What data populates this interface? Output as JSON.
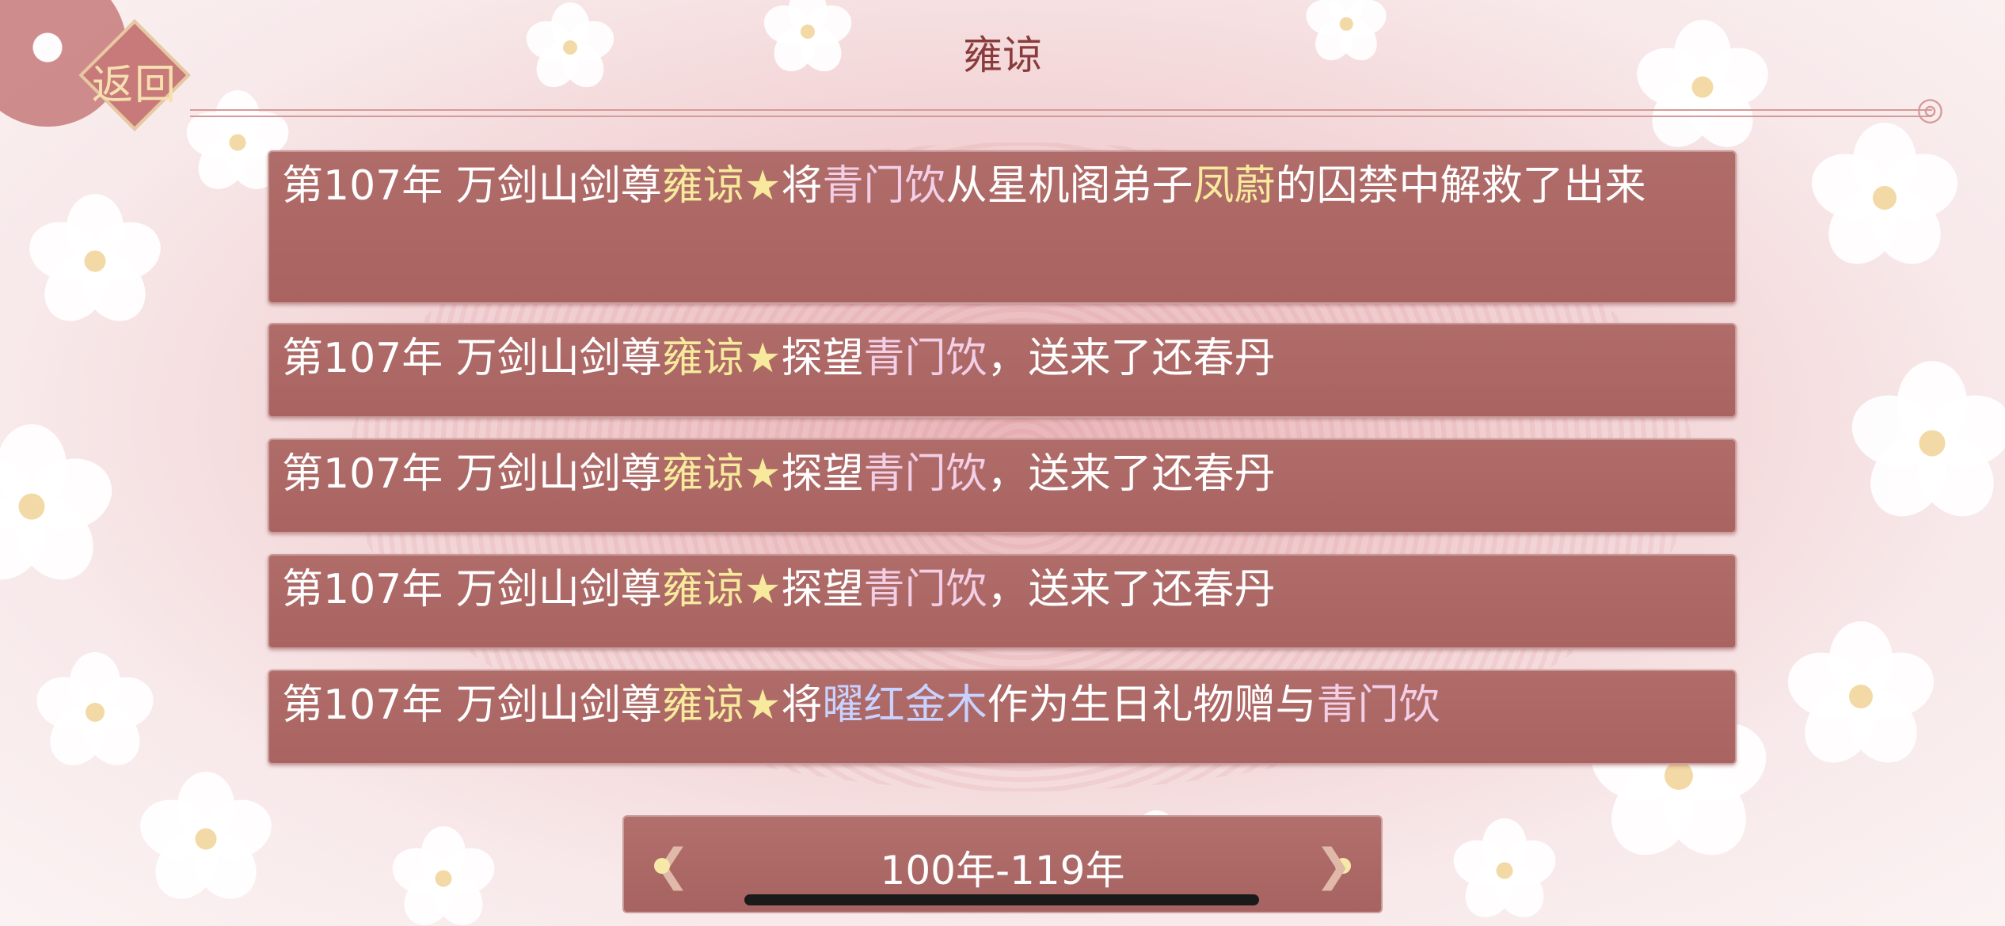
{
  "header": {
    "back_label": "返回",
    "title": "雍谅"
  },
  "events": [
    {
      "segments": [
        {
          "text": "第107年 万剑山剑尊",
          "color": "white"
        },
        {
          "text": "雍谅",
          "color": "yellow"
        },
        {
          "text": "★",
          "color": "yellow"
        },
        {
          "text": "将",
          "color": "white"
        },
        {
          "text": "青门饮",
          "color": "pink"
        },
        {
          "text": "从星机阁弟子",
          "color": "white"
        },
        {
          "text": "凤蔚",
          "color": "yellow"
        },
        {
          "text": "的囚禁中解救了出来",
          "color": "white"
        }
      ]
    },
    {
      "segments": [
        {
          "text": "第107年 万剑山剑尊",
          "color": "white"
        },
        {
          "text": "雍谅",
          "color": "yellow"
        },
        {
          "text": "★",
          "color": "yellow"
        },
        {
          "text": "探望",
          "color": "white"
        },
        {
          "text": "青门饮",
          "color": "pink"
        },
        {
          "text": "，送来了还春丹",
          "color": "white"
        }
      ]
    },
    {
      "segments": [
        {
          "text": "第107年 万剑山剑尊",
          "color": "white"
        },
        {
          "text": "雍谅",
          "color": "yellow"
        },
        {
          "text": "★",
          "color": "yellow"
        },
        {
          "text": "探望",
          "color": "white"
        },
        {
          "text": "青门饮",
          "color": "pink"
        },
        {
          "text": "，送来了还春丹",
          "color": "white"
        }
      ]
    },
    {
      "segments": [
        {
          "text": "第107年 万剑山剑尊",
          "color": "white"
        },
        {
          "text": "雍谅",
          "color": "yellow"
        },
        {
          "text": "★",
          "color": "yellow"
        },
        {
          "text": "探望",
          "color": "white"
        },
        {
          "text": "青门饮",
          "color": "pink"
        },
        {
          "text": "，送来了还春丹",
          "color": "white"
        }
      ]
    },
    {
      "segments": [
        {
          "text": "第107年 万剑山剑尊",
          "color": "white"
        },
        {
          "text": "雍谅",
          "color": "yellow"
        },
        {
          "text": "★",
          "color": "yellow"
        },
        {
          "text": "将",
          "color": "white"
        },
        {
          "text": "曜红金木",
          "color": "blue"
        },
        {
          "text": "作为生日礼物赠与",
          "color": "white"
        },
        {
          "text": "青门饮",
          "color": "pink"
        }
      ]
    }
  ],
  "footer": {
    "range_label": "100年-119年",
    "prev_icon": "scroll-ornament-left-icon",
    "next_icon": "scroll-ornament-right-icon"
  },
  "colors": {
    "white": "#ffffff",
    "yellow": "#f7ea9c",
    "pink": "#f2cfe6",
    "blue": "#c9d2ff",
    "card": "#ad6866",
    "title": "#8a3c3c"
  }
}
